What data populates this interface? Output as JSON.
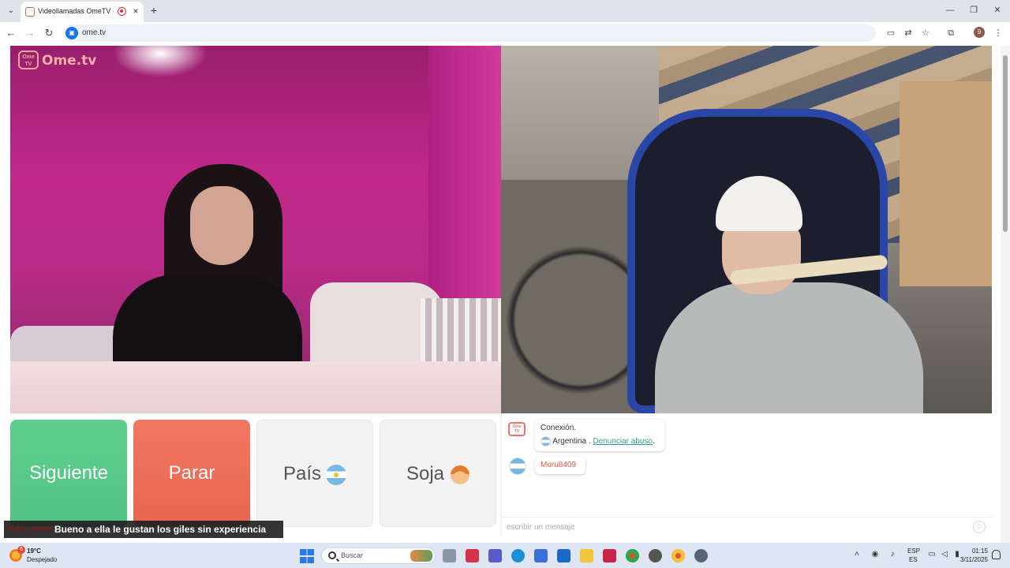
{
  "browser": {
    "tab_title": "Videollamadas OmeTV — A",
    "new_tab_label": "+",
    "url": "ome.tv",
    "profile_initial": "9"
  },
  "page": {
    "logo_badge": "Ome TV",
    "logo_text": "Ome.tv",
    "buttons": {
      "next": "Siguiente",
      "stop": "Parar",
      "country": "País",
      "gender": "Soja"
    },
    "chat": {
      "system_title": "Conexión.",
      "system_country": "Argentina",
      "system_sep": " . ",
      "report_link": "Denunciar abuso",
      "report_suffix": ".",
      "stranger_name": "Moru8409",
      "input_placeholder": "escribir un mensaje"
    }
  },
  "subtitle": {
    "speaker": "sofia_vmec",
    "text": "Bueno a ella le gustan los giles sin experiencia"
  },
  "taskbar": {
    "weather_badge": "6",
    "weather_temp": "19°C",
    "weather_desc": "Despejado",
    "search_placeholder": "Buscar",
    "lang_line1": "ESP",
    "lang_line2": "ES",
    "time": "01:15",
    "date": "3/11/2025"
  },
  "colors": {
    "next_button": "#55c586",
    "stop_button": "#eb6b55",
    "brand": "#e9756a",
    "report_link": "#3a9a94"
  }
}
